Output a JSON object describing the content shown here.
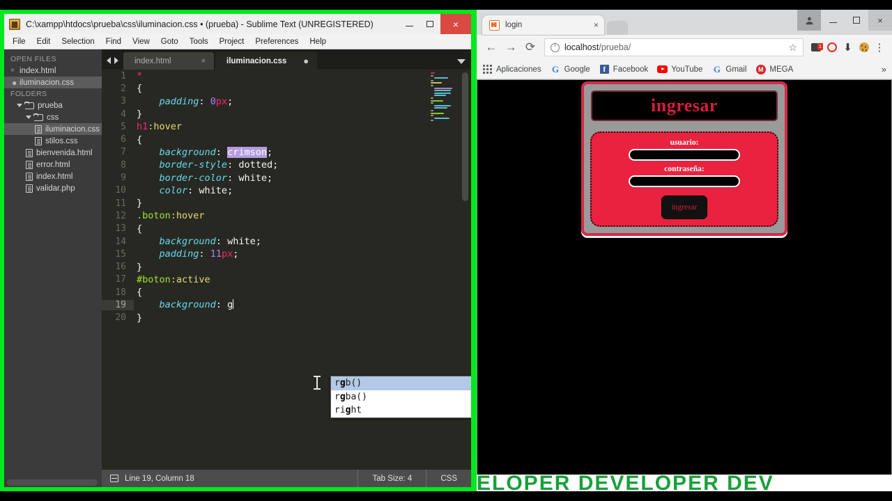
{
  "sublime": {
    "title": "C:\\xampp\\htdocs\\prueba\\css\\iluminacion.css • (prueba) - Sublime Text (UNREGISTERED)",
    "window_buttons": {
      "minimize": "–",
      "maximize": "□",
      "close": "×"
    },
    "menu": [
      "File",
      "Edit",
      "Selection",
      "Find",
      "View",
      "Goto",
      "Tools",
      "Project",
      "Preferences",
      "Help"
    ],
    "sidebar": {
      "open_files_header": "OPEN FILES",
      "open_files": [
        {
          "label": "index.html",
          "marker": "×",
          "selected": false
        },
        {
          "label": "iluminacion.css",
          "marker": "●",
          "selected": true
        }
      ],
      "folders_header": "FOLDERS",
      "tree": [
        {
          "label": "prueba",
          "type": "folder",
          "indent": 1,
          "selected": false
        },
        {
          "label": "css",
          "type": "folder",
          "indent": 2,
          "selected": false
        },
        {
          "label": "iluminacion.css",
          "type": "file",
          "indent": 3,
          "selected": true
        },
        {
          "label": "stilos.css",
          "type": "file",
          "indent": 3,
          "selected": false
        },
        {
          "label": "bienvenida.html",
          "type": "file",
          "indent": 2,
          "selected": false
        },
        {
          "label": "error.html",
          "type": "file",
          "indent": 2,
          "selected": false
        },
        {
          "label": "index.html",
          "type": "file",
          "indent": 2,
          "selected": false
        },
        {
          "label": "validar.php",
          "type": "file",
          "indent": 2,
          "selected": false
        }
      ]
    },
    "tabs": [
      {
        "label": "index.html",
        "active": false,
        "marker": "×"
      },
      {
        "label": "iluminacion.css",
        "active": true,
        "marker": "●"
      }
    ],
    "code_lines": [
      {
        "n": "1",
        "text": "*"
      },
      {
        "n": "2",
        "text": "{"
      },
      {
        "n": "3",
        "text": "    padding: 0px;"
      },
      {
        "n": "4",
        "text": "}"
      },
      {
        "n": "5",
        "text": "h1:hover"
      },
      {
        "n": "6",
        "text": "{"
      },
      {
        "n": "7",
        "text": "    background: crimson;"
      },
      {
        "n": "8",
        "text": "    border-style: dotted;"
      },
      {
        "n": "9",
        "text": "    border-color: white;"
      },
      {
        "n": "10",
        "text": "    color: white;"
      },
      {
        "n": "11",
        "text": "}"
      },
      {
        "n": "12",
        "text": ".boton:hover"
      },
      {
        "n": "13",
        "text": "{"
      },
      {
        "n": "14",
        "text": "    background: white;"
      },
      {
        "n": "15",
        "text": "    padding: 11px;"
      },
      {
        "n": "16",
        "text": "}"
      },
      {
        "n": "17",
        "text": "#boton:active"
      },
      {
        "n": "18",
        "text": "{"
      },
      {
        "n": "19",
        "text": "    background: g"
      },
      {
        "n": "20",
        "text": "}"
      }
    ],
    "autocomplete": {
      "items": [
        "rgb()",
        "rgba()",
        "right"
      ],
      "selected_index": 0,
      "match_char": "g"
    },
    "status": {
      "position": "Line 19, Column 18",
      "tab_size": "Tab Size: 4",
      "syntax": "CSS"
    },
    "colors": {
      "selector": "#f92672",
      "pseudo": "#e6db74",
      "class_selector": "#a6e22e",
      "property": "#66d9ef",
      "number": "#ae81ff",
      "unit": "#f92672",
      "value": "#f8f8f2",
      "selection_highlight": "#b49be0",
      "editor_bg": "#272822",
      "window_frame": "#00e81e"
    }
  },
  "chrome": {
    "tab": {
      "title": "login",
      "close": "×",
      "favicon": "xampp-icon"
    },
    "window_buttons": {
      "user": "👤",
      "minimize": "–",
      "maximize": "□",
      "close": "×"
    },
    "nav": {
      "back": "←",
      "forward": "→",
      "reload": "⟳"
    },
    "omnibox": {
      "security_icon": "info-icon",
      "host": "localhost",
      "path": "/prueba/",
      "bookmark_star": "☆"
    },
    "extensions": [
      {
        "name": "extension-badge-icon",
        "badge": "1"
      },
      {
        "name": "adblock-icon",
        "badge": ""
      },
      {
        "name": "download-icon",
        "badge": ""
      },
      {
        "name": "cookie-icon",
        "badge": ""
      }
    ],
    "menu_icon": "⋮",
    "bookmarks": [
      {
        "label": "Aplicaciones",
        "icon": "apps-grid-icon"
      },
      {
        "label": "Google",
        "icon": "google-icon"
      },
      {
        "label": "Facebook",
        "icon": "facebook-icon"
      },
      {
        "label": "YouTube",
        "icon": "youtube-icon"
      },
      {
        "label": "Gmail",
        "icon": "google-icon"
      },
      {
        "label": "MEGA",
        "icon": "mega-icon"
      }
    ],
    "bookmarks_overflow": "»"
  },
  "page": {
    "heading": "ingresar",
    "fields": [
      {
        "label": "usuario:",
        "value": "",
        "type": "text"
      },
      {
        "label": "contraseña:",
        "value": "",
        "type": "password"
      }
    ],
    "submit_label": "ingresar",
    "watermark": "VELOPER    DEVELOPER    DEV",
    "colors": {
      "panel_bg": "#e8223f",
      "frame_border": "#d42b47",
      "container_bg": "#9a9a9a",
      "heading_text": "#d81c3f",
      "watermark_text": "#18a03a"
    }
  }
}
